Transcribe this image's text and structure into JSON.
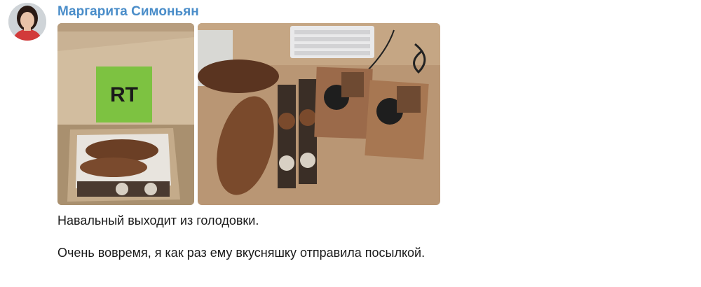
{
  "post": {
    "author": "Маргарита Симоньян",
    "paragraphs": [
      "Навальный выходит из голодовки.",
      "Очень вовремя, я как раз ему вкусняшку отправила посылкой."
    ]
  },
  "photo_1": {
    "logo_text": "RT"
  },
  "colors": {
    "author_name": "#4a8dc9",
    "cardboard": "#c9b294",
    "rt_green": "#7dc241",
    "table_wood": "#b99674"
  }
}
